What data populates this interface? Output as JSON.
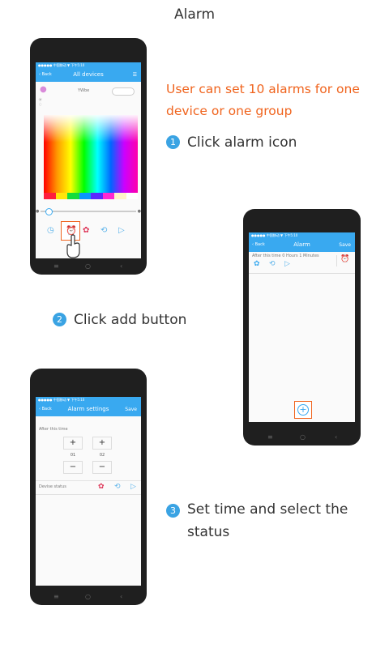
{
  "title": "Alarm",
  "intro": "User can set 10 alarms for one device or one group",
  "steps": [
    {
      "num": "1",
      "text": "Click alarm icon"
    },
    {
      "num": "2",
      "text": "Click add button"
    },
    {
      "num": "3",
      "text": "Set time and select the status"
    }
  ],
  "phone1": {
    "status": "●●●●● 中国移动  ▼        下午5:10",
    "back": "Back",
    "title": "All devices",
    "device_name": "YWbe",
    "tab_icons": [
      "clock-icon",
      "alarm-icon",
      "color-circles-icon",
      "history-icon",
      "play-icon"
    ]
  },
  "phone2": {
    "status": "●●●●● 中国移动  ▼        下午5:10",
    "back": "Back",
    "title": "Alarm",
    "save": "Save",
    "alarm_text": "After this time 0 Hours 1 Minutes"
  },
  "phone3": {
    "status": "●●●●● 中国移动  ▼        下午5:10",
    "back": "Back",
    "title": "Alarm settings",
    "save": "Save",
    "after_label": "After this time",
    "hours_value": "01",
    "minutes_value": "02",
    "device_status_label": "Devise status"
  },
  "colors": {
    "accent": "#39a9f0",
    "orange": "#f0641e",
    "step": "#3aa3e3"
  }
}
